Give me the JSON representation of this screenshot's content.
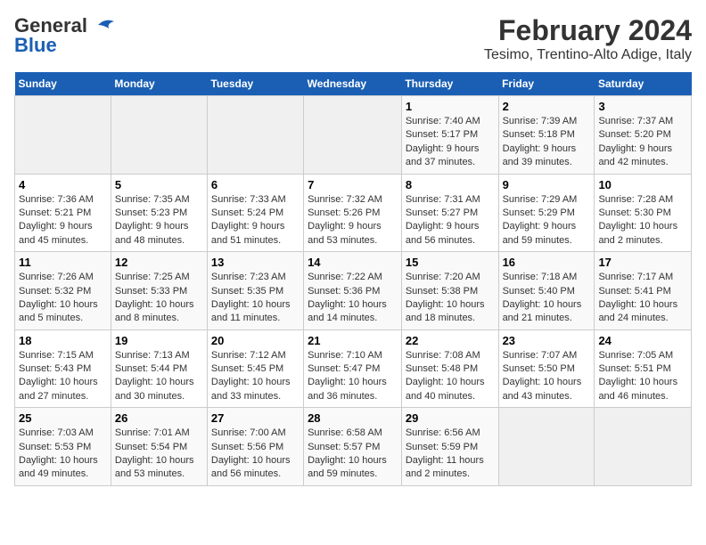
{
  "header": {
    "logo_line1": "General",
    "logo_line2": "Blue",
    "title": "February 2024",
    "subtitle": "Tesimo, Trentino-Alto Adige, Italy"
  },
  "columns": [
    "Sunday",
    "Monday",
    "Tuesday",
    "Wednesday",
    "Thursday",
    "Friday",
    "Saturday"
  ],
  "weeks": [
    [
      {
        "day": "",
        "info": ""
      },
      {
        "day": "",
        "info": ""
      },
      {
        "day": "",
        "info": ""
      },
      {
        "day": "",
        "info": ""
      },
      {
        "day": "1",
        "info": "Sunrise: 7:40 AM\nSunset: 5:17 PM\nDaylight: 9 hours\nand 37 minutes."
      },
      {
        "day": "2",
        "info": "Sunrise: 7:39 AM\nSunset: 5:18 PM\nDaylight: 9 hours\nand 39 minutes."
      },
      {
        "day": "3",
        "info": "Sunrise: 7:37 AM\nSunset: 5:20 PM\nDaylight: 9 hours\nand 42 minutes."
      }
    ],
    [
      {
        "day": "4",
        "info": "Sunrise: 7:36 AM\nSunset: 5:21 PM\nDaylight: 9 hours\nand 45 minutes."
      },
      {
        "day": "5",
        "info": "Sunrise: 7:35 AM\nSunset: 5:23 PM\nDaylight: 9 hours\nand 48 minutes."
      },
      {
        "day": "6",
        "info": "Sunrise: 7:33 AM\nSunset: 5:24 PM\nDaylight: 9 hours\nand 51 minutes."
      },
      {
        "day": "7",
        "info": "Sunrise: 7:32 AM\nSunset: 5:26 PM\nDaylight: 9 hours\nand 53 minutes."
      },
      {
        "day": "8",
        "info": "Sunrise: 7:31 AM\nSunset: 5:27 PM\nDaylight: 9 hours\nand 56 minutes."
      },
      {
        "day": "9",
        "info": "Sunrise: 7:29 AM\nSunset: 5:29 PM\nDaylight: 9 hours\nand 59 minutes."
      },
      {
        "day": "10",
        "info": "Sunrise: 7:28 AM\nSunset: 5:30 PM\nDaylight: 10 hours\nand 2 minutes."
      }
    ],
    [
      {
        "day": "11",
        "info": "Sunrise: 7:26 AM\nSunset: 5:32 PM\nDaylight: 10 hours\nand 5 minutes."
      },
      {
        "day": "12",
        "info": "Sunrise: 7:25 AM\nSunset: 5:33 PM\nDaylight: 10 hours\nand 8 minutes."
      },
      {
        "day": "13",
        "info": "Sunrise: 7:23 AM\nSunset: 5:35 PM\nDaylight: 10 hours\nand 11 minutes."
      },
      {
        "day": "14",
        "info": "Sunrise: 7:22 AM\nSunset: 5:36 PM\nDaylight: 10 hours\nand 14 minutes."
      },
      {
        "day": "15",
        "info": "Sunrise: 7:20 AM\nSunset: 5:38 PM\nDaylight: 10 hours\nand 18 minutes."
      },
      {
        "day": "16",
        "info": "Sunrise: 7:18 AM\nSunset: 5:40 PM\nDaylight: 10 hours\nand 21 minutes."
      },
      {
        "day": "17",
        "info": "Sunrise: 7:17 AM\nSunset: 5:41 PM\nDaylight: 10 hours\nand 24 minutes."
      }
    ],
    [
      {
        "day": "18",
        "info": "Sunrise: 7:15 AM\nSunset: 5:43 PM\nDaylight: 10 hours\nand 27 minutes."
      },
      {
        "day": "19",
        "info": "Sunrise: 7:13 AM\nSunset: 5:44 PM\nDaylight: 10 hours\nand 30 minutes."
      },
      {
        "day": "20",
        "info": "Sunrise: 7:12 AM\nSunset: 5:45 PM\nDaylight: 10 hours\nand 33 minutes."
      },
      {
        "day": "21",
        "info": "Sunrise: 7:10 AM\nSunset: 5:47 PM\nDaylight: 10 hours\nand 36 minutes."
      },
      {
        "day": "22",
        "info": "Sunrise: 7:08 AM\nSunset: 5:48 PM\nDaylight: 10 hours\nand 40 minutes."
      },
      {
        "day": "23",
        "info": "Sunrise: 7:07 AM\nSunset: 5:50 PM\nDaylight: 10 hours\nand 43 minutes."
      },
      {
        "day": "24",
        "info": "Sunrise: 7:05 AM\nSunset: 5:51 PM\nDaylight: 10 hours\nand 46 minutes."
      }
    ],
    [
      {
        "day": "25",
        "info": "Sunrise: 7:03 AM\nSunset: 5:53 PM\nDaylight: 10 hours\nand 49 minutes."
      },
      {
        "day": "26",
        "info": "Sunrise: 7:01 AM\nSunset: 5:54 PM\nDaylight: 10 hours\nand 53 minutes."
      },
      {
        "day": "27",
        "info": "Sunrise: 7:00 AM\nSunset: 5:56 PM\nDaylight: 10 hours\nand 56 minutes."
      },
      {
        "day": "28",
        "info": "Sunrise: 6:58 AM\nSunset: 5:57 PM\nDaylight: 10 hours\nand 59 minutes."
      },
      {
        "day": "29",
        "info": "Sunrise: 6:56 AM\nSunset: 5:59 PM\nDaylight: 11 hours\nand 2 minutes."
      },
      {
        "day": "",
        "info": ""
      },
      {
        "day": "",
        "info": ""
      }
    ]
  ]
}
